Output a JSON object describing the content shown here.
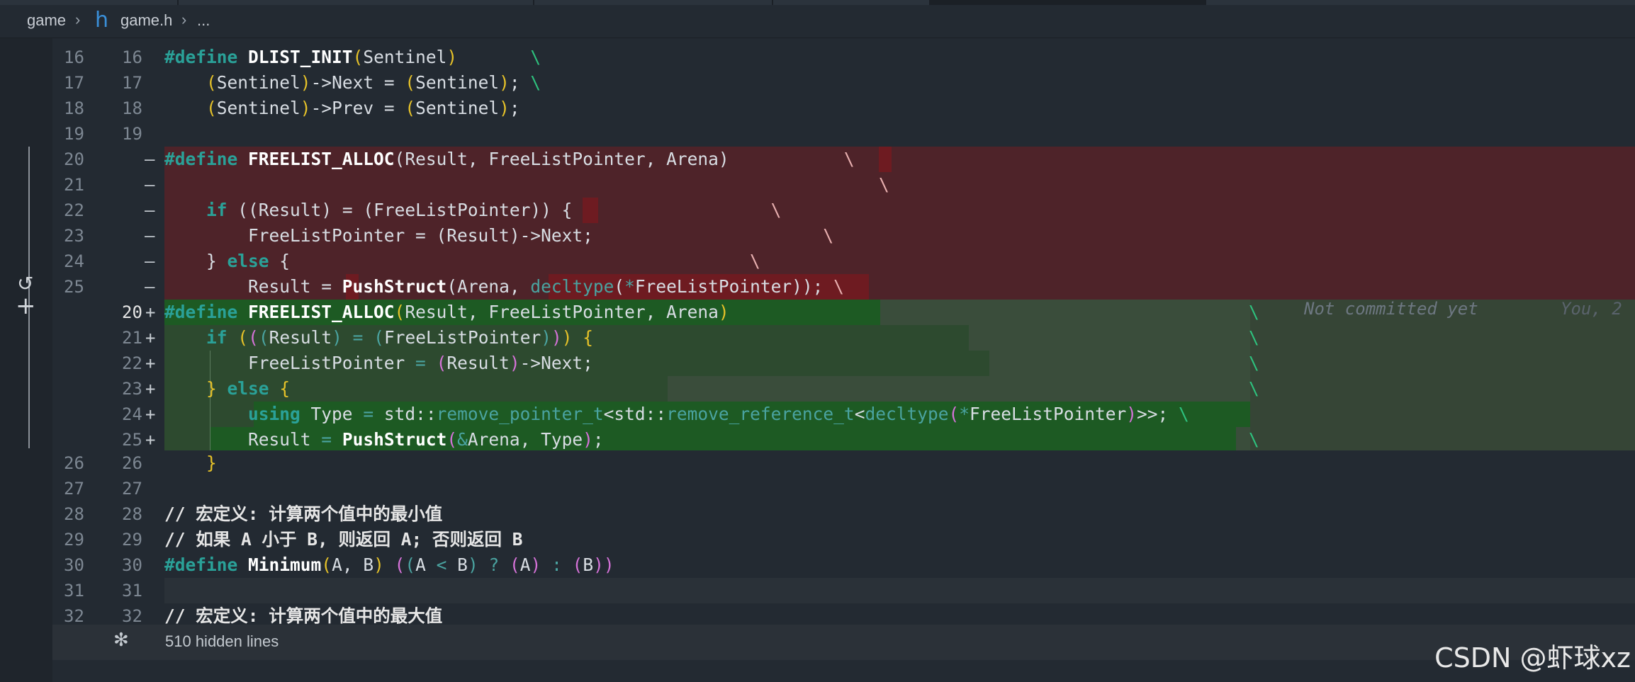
{
  "breadcrumb": {
    "folder": "game",
    "file": "game.h",
    "more": "...",
    "file_icon_glyph": "h",
    "sep": "›"
  },
  "colors": {
    "removed_bg": "#4e2329",
    "removed_word_bg": "#6e1b21",
    "added_bg": "#2d4a2f",
    "added_word_bg": "#1d5a23",
    "bg": "#232a32"
  },
  "lines": {
    "l16": {
      "old": "16",
      "new": "16"
    },
    "l17": {
      "old": "17",
      "new": "17"
    },
    "l18": {
      "old": "18",
      "new": "18"
    },
    "l19": {
      "old": "19",
      "new": "19"
    },
    "r20": {
      "old": "20",
      "marker": "—"
    },
    "r21": {
      "old": "21",
      "marker": "—"
    },
    "r22": {
      "old": "22",
      "marker": "—"
    },
    "r23": {
      "old": "23",
      "marker": "—"
    },
    "r24": {
      "old": "24",
      "marker": "—"
    },
    "r25": {
      "old": "25",
      "marker": "—"
    },
    "a20": {
      "new": "20",
      "marker": "+"
    },
    "a21": {
      "new": "21",
      "marker": "+"
    },
    "a22": {
      "new": "22",
      "marker": "+"
    },
    "a23": {
      "new": "23",
      "marker": "+"
    },
    "a24": {
      "new": "24",
      "marker": "+"
    },
    "a25": {
      "new": "25",
      "marker": "+"
    },
    "l26": {
      "old": "26",
      "new": "26"
    },
    "l27": {
      "old": "27",
      "new": "27"
    },
    "l28": {
      "old": "28",
      "new": "28"
    },
    "l29": {
      "old": "29",
      "new": "29"
    },
    "l30": {
      "old": "30",
      "new": "30"
    },
    "l31": {
      "old": "31",
      "new": "31"
    },
    "l32": {
      "old": "32",
      "new": "32"
    }
  },
  "code": {
    "define": "#define",
    "dlist_init": "DLIST_INIT",
    "sentinel": "Sentinel",
    "next_assign": "->Next = ",
    "prev_assign": "->Prev = ",
    "freelist_alloc": "FREELIST_ALLOC",
    "params": "Result, FreeListPointer, Arena",
    "if_kw": "if",
    "else_kw": "else",
    "using_kw": "using",
    "result": "Result",
    "freelistpointer": "FreeListPointer",
    "next": "->Next;",
    "push_struct": "PushStruct",
    "arena_comma": "Arena, ",
    "decltype": "decltype",
    "star": "*",
    "type": "Type",
    "std": "std::",
    "remove_pointer": "remove_pointer_t",
    "remove_reference": "remove_reference_t",
    "amp_arena": "&Arena",
    "comment_min_title": "// 宏定义: 计算两个值中的最小值",
    "comment_min_desc": "// 如果 A 小于 B, 则返回 A; 否则返回 B",
    "minimum": "Minimum",
    "comment_max_title": "// 宏定义: 计算两个值中的最大值",
    "backslash": "\\"
  },
  "blame": {
    "status": "Not committed yet",
    "author": "You, 2"
  },
  "folded": {
    "label": "510 hidden lines",
    "icon": "snowflake-fold-icon"
  },
  "gutter_icons": {
    "revert": "↺",
    "add": "+"
  },
  "watermark": "CSDN @虾球xz"
}
